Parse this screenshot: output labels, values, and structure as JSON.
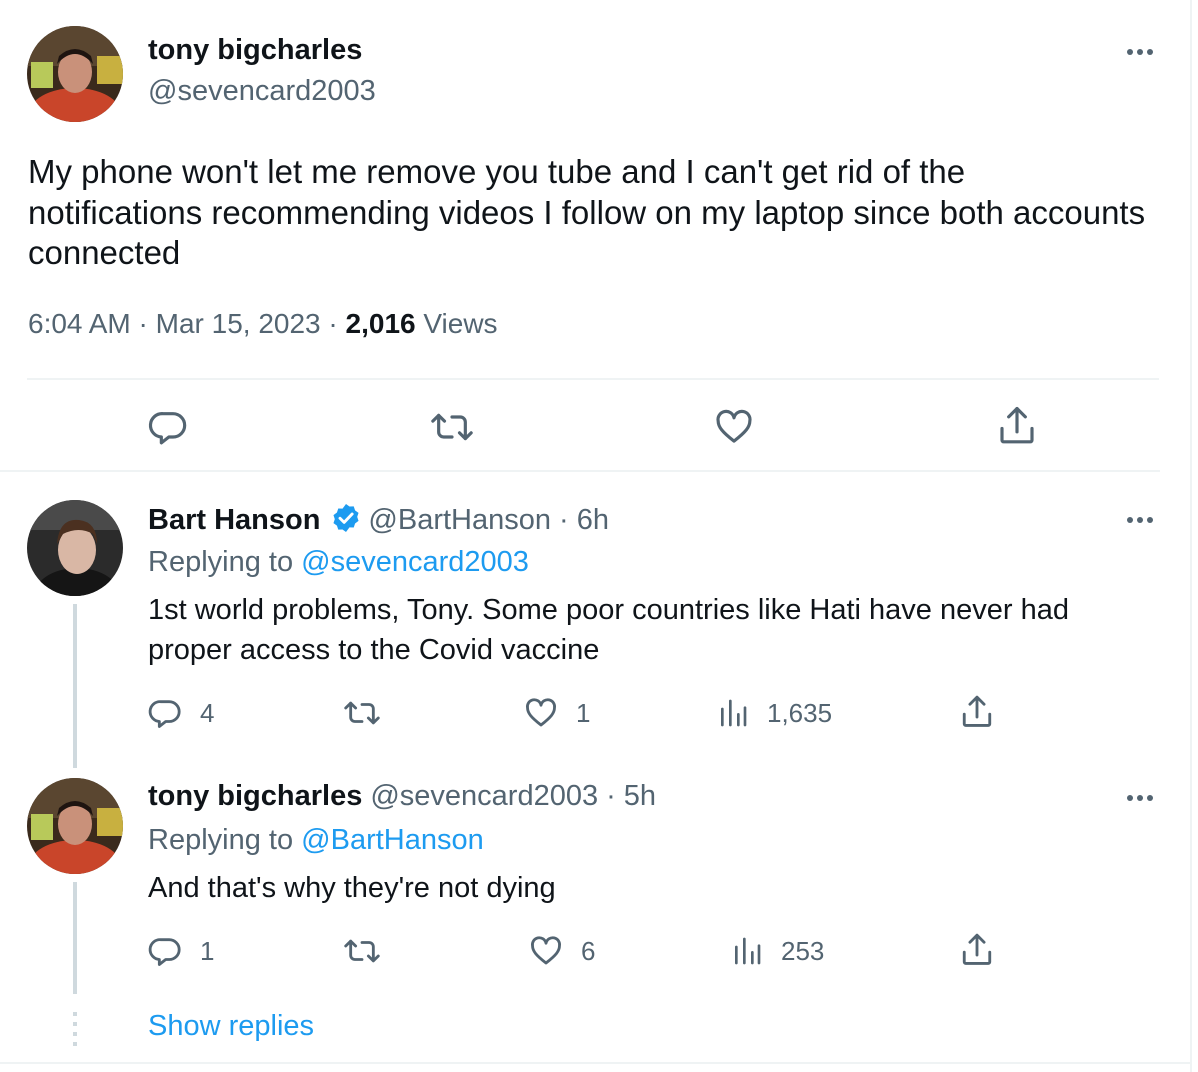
{
  "main_tweet": {
    "name": "tony bigcharles",
    "handle": "@sevencard2003",
    "text": "My phone won't let me remove you tube and I can't get rid of the notifications recommending videos I follow on my laptop since both accounts connected",
    "time": "6:04 AM",
    "sep1": "·",
    "date": "Mar 15, 2023",
    "sep2": "·",
    "views_count": "2,016",
    "views_label": "Views",
    "actions": [
      "reply",
      "retweet",
      "like",
      "share"
    ]
  },
  "replies": [
    {
      "name": "Bart Hanson",
      "verified": true,
      "handle": "@BartHanson",
      "time": "· 6h",
      "replying_prefix": "Replying to",
      "replying_to": "@sevencard2003",
      "text": "1st world problems, Tony. Some poor countries like Hati have never had proper access to the Covid vaccine",
      "counts": {
        "replies": "4",
        "likes": "1",
        "views": "1,635"
      }
    },
    {
      "name": "tony bigcharles",
      "verified": false,
      "handle": "@sevencard2003",
      "time": "· 5h",
      "replying_prefix": "Replying to",
      "replying_to": "@BartHanson",
      "text": "And that's why they're not dying",
      "counts": {
        "replies": "1",
        "likes": "6",
        "views": "253"
      }
    }
  ],
  "show_replies": "Show replies",
  "colors": {
    "accent": "#1d9bf0",
    "secondary_text": "#536471",
    "primary_text": "#0f1419"
  }
}
